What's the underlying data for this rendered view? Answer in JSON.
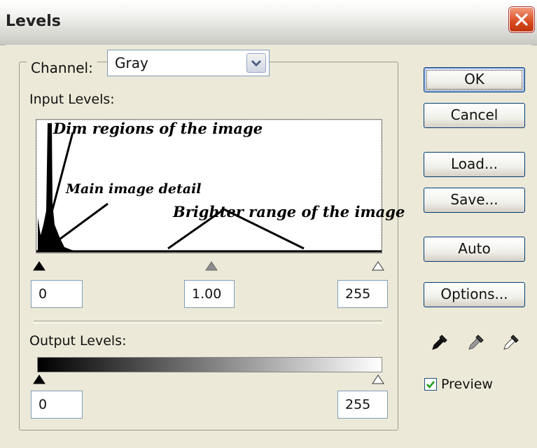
{
  "window": {
    "title": "Levels"
  },
  "channel": {
    "label": "Channel:",
    "value": "Gray"
  },
  "input_levels": {
    "label": "Input Levels:",
    "black": "0",
    "gamma": "1.00",
    "white": "255"
  },
  "output_levels": {
    "label": "Output Levels:",
    "black": "0",
    "white": "255"
  },
  "annotations": {
    "dim": "Dim regions of the image",
    "main": "Main image detail",
    "bright": "Brighter range of the image"
  },
  "buttons": {
    "ok": "OK",
    "cancel": "Cancel",
    "load": "Load...",
    "save": "Save...",
    "auto": "Auto",
    "options": "Options..."
  },
  "preview": {
    "label": "Preview",
    "checked": true
  },
  "icons": [
    "close-icon",
    "dropdown-arrow-icon",
    "black-eyedropper-icon",
    "gray-eyedropper-icon",
    "white-eyedropper-icon",
    "checkmark-icon"
  ],
  "colors": {
    "accent_border": "#003c74",
    "close_button": "#d84a1f",
    "check": "#21a121"
  }
}
